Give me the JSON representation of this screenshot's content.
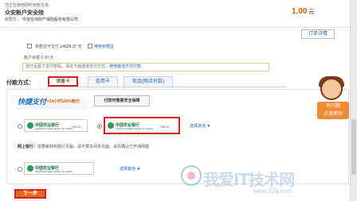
{
  "header": {
    "order_title": "您正在使用即时到账交易",
    "account_name": "众安账户安全险",
    "payee_label": "收款方：",
    "payee_value": "众安在线财产保险股份有限公司",
    "amount": "1.00",
    "amount_unit": "元"
  },
  "order_detail_button": "订单详情",
  "balance": {
    "label": "余额宝可支付",
    "value": "14629.37 元",
    "pay_link": "使用余额宝",
    "account_balance": "账户余额 0.00 元"
  },
  "notice": {
    "text": "您已设置了支付密码，请在下面选择支付方式，",
    "link": "使用其他方式付款"
  },
  "payment_method": {
    "label": "付款方式：",
    "tabs": [
      {
        "label": "储蓄卡",
        "active": true
      },
      {
        "label": "信用卡",
        "active": false
      },
      {
        "label": "现金(网点付款)",
        "active": false
      }
    ]
  },
  "quick_pay": {
    "logo": "快捷支付",
    "slogan": "7×24小时100%赔付",
    "security_badge": "付款时需要安全保障"
  },
  "cards": [
    {
      "bank": "中国农业银行",
      "bank_en": "AGRICULTURAL BANK OF CHINA",
      "tail": "**0123",
      "selected": false
    },
    {
      "bank": "中国农业银行",
      "bank_en": "AGRICULTURAL BANK OF CHINA",
      "tail": "**8678",
      "selected": true
    }
  ],
  "choose_other_1": "选择其他",
  "login_text_prefix": "网上银行：",
  "login_text": "需要跳转到银行页面，请不要关闭本页面，请先确认已开通网银",
  "netbank_card": {
    "bank": "中国农业银行",
    "bank_en": "AGRICULTURAL BANK OF CHINA"
  },
  "choose_other_2": "选择其他",
  "next_button": "下一步",
  "chat": {
    "line1": "有问题",
    "line2": "点我帮你"
  },
  "watermark": {
    "text": "我爱IT技术网",
    "url": "www.52ij.com"
  },
  "colors": {
    "accent": "#e05a00",
    "link": "#1a5fb4",
    "highlight": "#d62020",
    "button": "#e66a1b"
  }
}
